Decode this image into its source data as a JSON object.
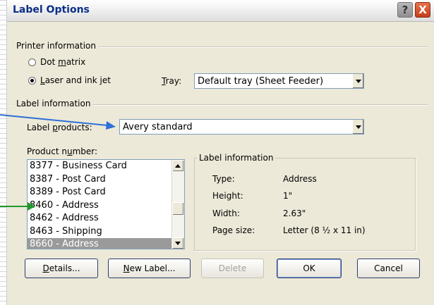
{
  "dialog": {
    "title": "Label Options",
    "help_glyph": "?",
    "close_glyph": "X"
  },
  "printer_info": {
    "group_label": "Printer information",
    "dot_matrix": {
      "pre": "Dot ",
      "key": "m",
      "post": "atrix",
      "checked": false
    },
    "laser": {
      "pre": "",
      "key": "L",
      "post": "aser and ink jet",
      "checked": true
    },
    "tray_label": {
      "pre": "",
      "key": "T",
      "post": "ray:"
    },
    "tray_value": "Default tray (Sheet Feeder)"
  },
  "label_info": {
    "group_label": "Label information",
    "products_label": {
      "pre": "Label ",
      "key": "p",
      "post": "roducts:"
    },
    "products_value": "Avery standard",
    "product_number_label": {
      "pre": "Product n",
      "key": "u",
      "post": "mber:"
    },
    "product_numbers": [
      "8377 - Business Card",
      "8387 - Post Card",
      "8389 - Post Card",
      "8460 - Address",
      "8462 - Address",
      "8463 - Shipping",
      "8660 - Address"
    ],
    "selected_product": "8660 - Address"
  },
  "details_panel": {
    "group_label": "Label information",
    "rows": [
      {
        "key": "Type:",
        "value": "Address"
      },
      {
        "key": "Height:",
        "value": "1\""
      },
      {
        "key": "Width:",
        "value": "2.63\""
      },
      {
        "key": "Page size:",
        "value": "Letter (8 ½ x 11 in)"
      }
    ]
  },
  "buttons": {
    "details": {
      "pre": "",
      "key": "D",
      "post": "etails..."
    },
    "new_label": {
      "pre": "",
      "key": "N",
      "post": "ew Label..."
    },
    "delete": "Delete",
    "ok": "OK",
    "cancel": "Cancel"
  },
  "colors": {
    "dialog_bg": "#ece9d8",
    "title_text": "#0b2f8a",
    "arrow_blue": "#2f6fd6",
    "arrow_green": "#1f9a2a",
    "selection": "#9a9a9a"
  }
}
